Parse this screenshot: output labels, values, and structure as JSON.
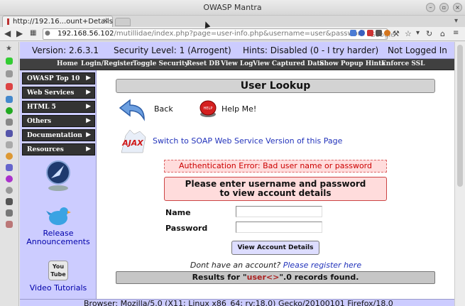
{
  "window": {
    "title": "OWASP Mantra"
  },
  "tab": {
    "label": "http://192.16...ount+Details",
    "close": "×"
  },
  "url": {
    "domain": "192.168.56.102",
    "path": "/mutillidae/index.php?page=user-info.php&username=user&password",
    "search_label": "Google"
  },
  "status": {
    "version": "Version: 2.6.3.1",
    "security": "Security Level: 1 (Arrogent)",
    "hints": "Hints: Disabled (0 - I try harder)",
    "login": "Not Logged In"
  },
  "menu": [
    "Home",
    "Login/Register",
    "Toggle Security",
    "Reset DB",
    "View Log",
    "View Captured Data",
    "Show Popup Hints",
    "Enforce SSL"
  ],
  "left_menu": [
    "OWASP Top 10",
    "Web Services",
    "HTML 5",
    "Others",
    "Documentation",
    "Resources"
  ],
  "promos": {
    "release": "Release Announcements",
    "video": "Video Tutorials",
    "youtube": "You Tube"
  },
  "page": {
    "title": "User Lookup",
    "back": "Back",
    "help": "Help Me!",
    "ajax": "AJAX",
    "help_icon_text": "HELP",
    "soap_link": "Switch to SOAP Web Service Version of this Page",
    "auth_error": "Authentication Error: Bad user name or password",
    "prompt_line1": "Please enter username and password",
    "prompt_line2": "to view account details",
    "name_label": "Name",
    "password_label": "Password",
    "name_value": "",
    "password_value": "",
    "button": "View Account Details",
    "no_account": "Dont have an account?",
    "register_link": "Please register here",
    "results_prefix": "Results for \"",
    "results_user": "user<>",
    "results_suffix": "\".0 records found."
  },
  "browser_line": "Browser: Mozilla/5.0 (X11; Linux x86_64; rv:18.0) Gecko/20100101 Firefox/18.0",
  "colors": {
    "status_bg": "#ccccff",
    "menu_bg": "#404040",
    "error": "#cc0000",
    "link": "#2233bb"
  }
}
